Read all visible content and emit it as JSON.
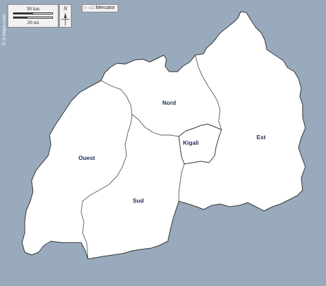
{
  "map": {
    "watermark": "© d-maps.com",
    "scale": {
      "km_label": "30 km",
      "mi_label": "20 mi"
    },
    "north_label": "N",
    "projection": {
      "icon": "projection-icon",
      "label": "Mercator"
    },
    "regions": [
      {
        "id": "nord",
        "label": "Nord"
      },
      {
        "id": "est",
        "label": "Est"
      },
      {
        "id": "kigali",
        "label": "Kigali"
      },
      {
        "id": "ouest",
        "label": "Ouest"
      },
      {
        "id": "sud",
        "label": "Sud"
      }
    ],
    "colors": {
      "water": "#98aabb",
      "land": "#ffffff",
      "border": "#333333",
      "label": "#1b2a55"
    }
  }
}
